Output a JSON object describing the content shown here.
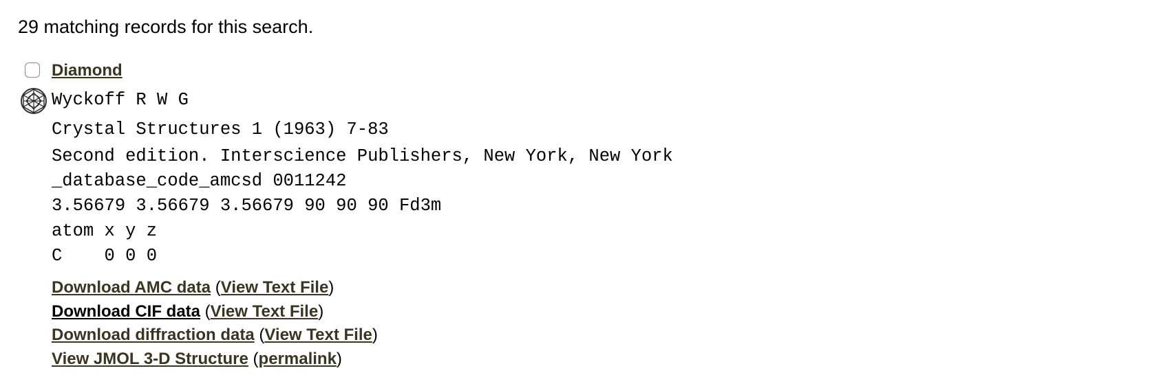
{
  "results": {
    "count_text": "29 matching records for this search."
  },
  "record": {
    "title": "Diamond",
    "author": "Wyckoff R W G",
    "reference": "Crystal Structures 1 (1963) 7-83",
    "edition": "Second edition. Interscience Publishers, New York, New York",
    "database_code": "_database_code_amcsd 0011242",
    "cell": "3.56679 3.56679 3.56679 90 90 90 Fd3m",
    "atom_header": "atom x y z",
    "atom_row": "C    0 0 0"
  },
  "links": [
    {
      "label": "Download AMC data",
      "sub_label": "View Text File"
    },
    {
      "label": "Download CIF data",
      "sub_label": "View Text File"
    },
    {
      "label": "Download diffraction data",
      "sub_label": "View Text File"
    },
    {
      "label": "View JMOL 3-D Structure",
      "sub_label": "permalink"
    }
  ],
  "punctuation": {
    "open": "(",
    "close": ")"
  },
  "icons": {
    "checkbox": "checkbox-unchecked",
    "structure": "crystal-structure-icon"
  },
  "colors": {
    "link": "#3a3420",
    "visited_link": "#000000",
    "text": "#000000"
  }
}
